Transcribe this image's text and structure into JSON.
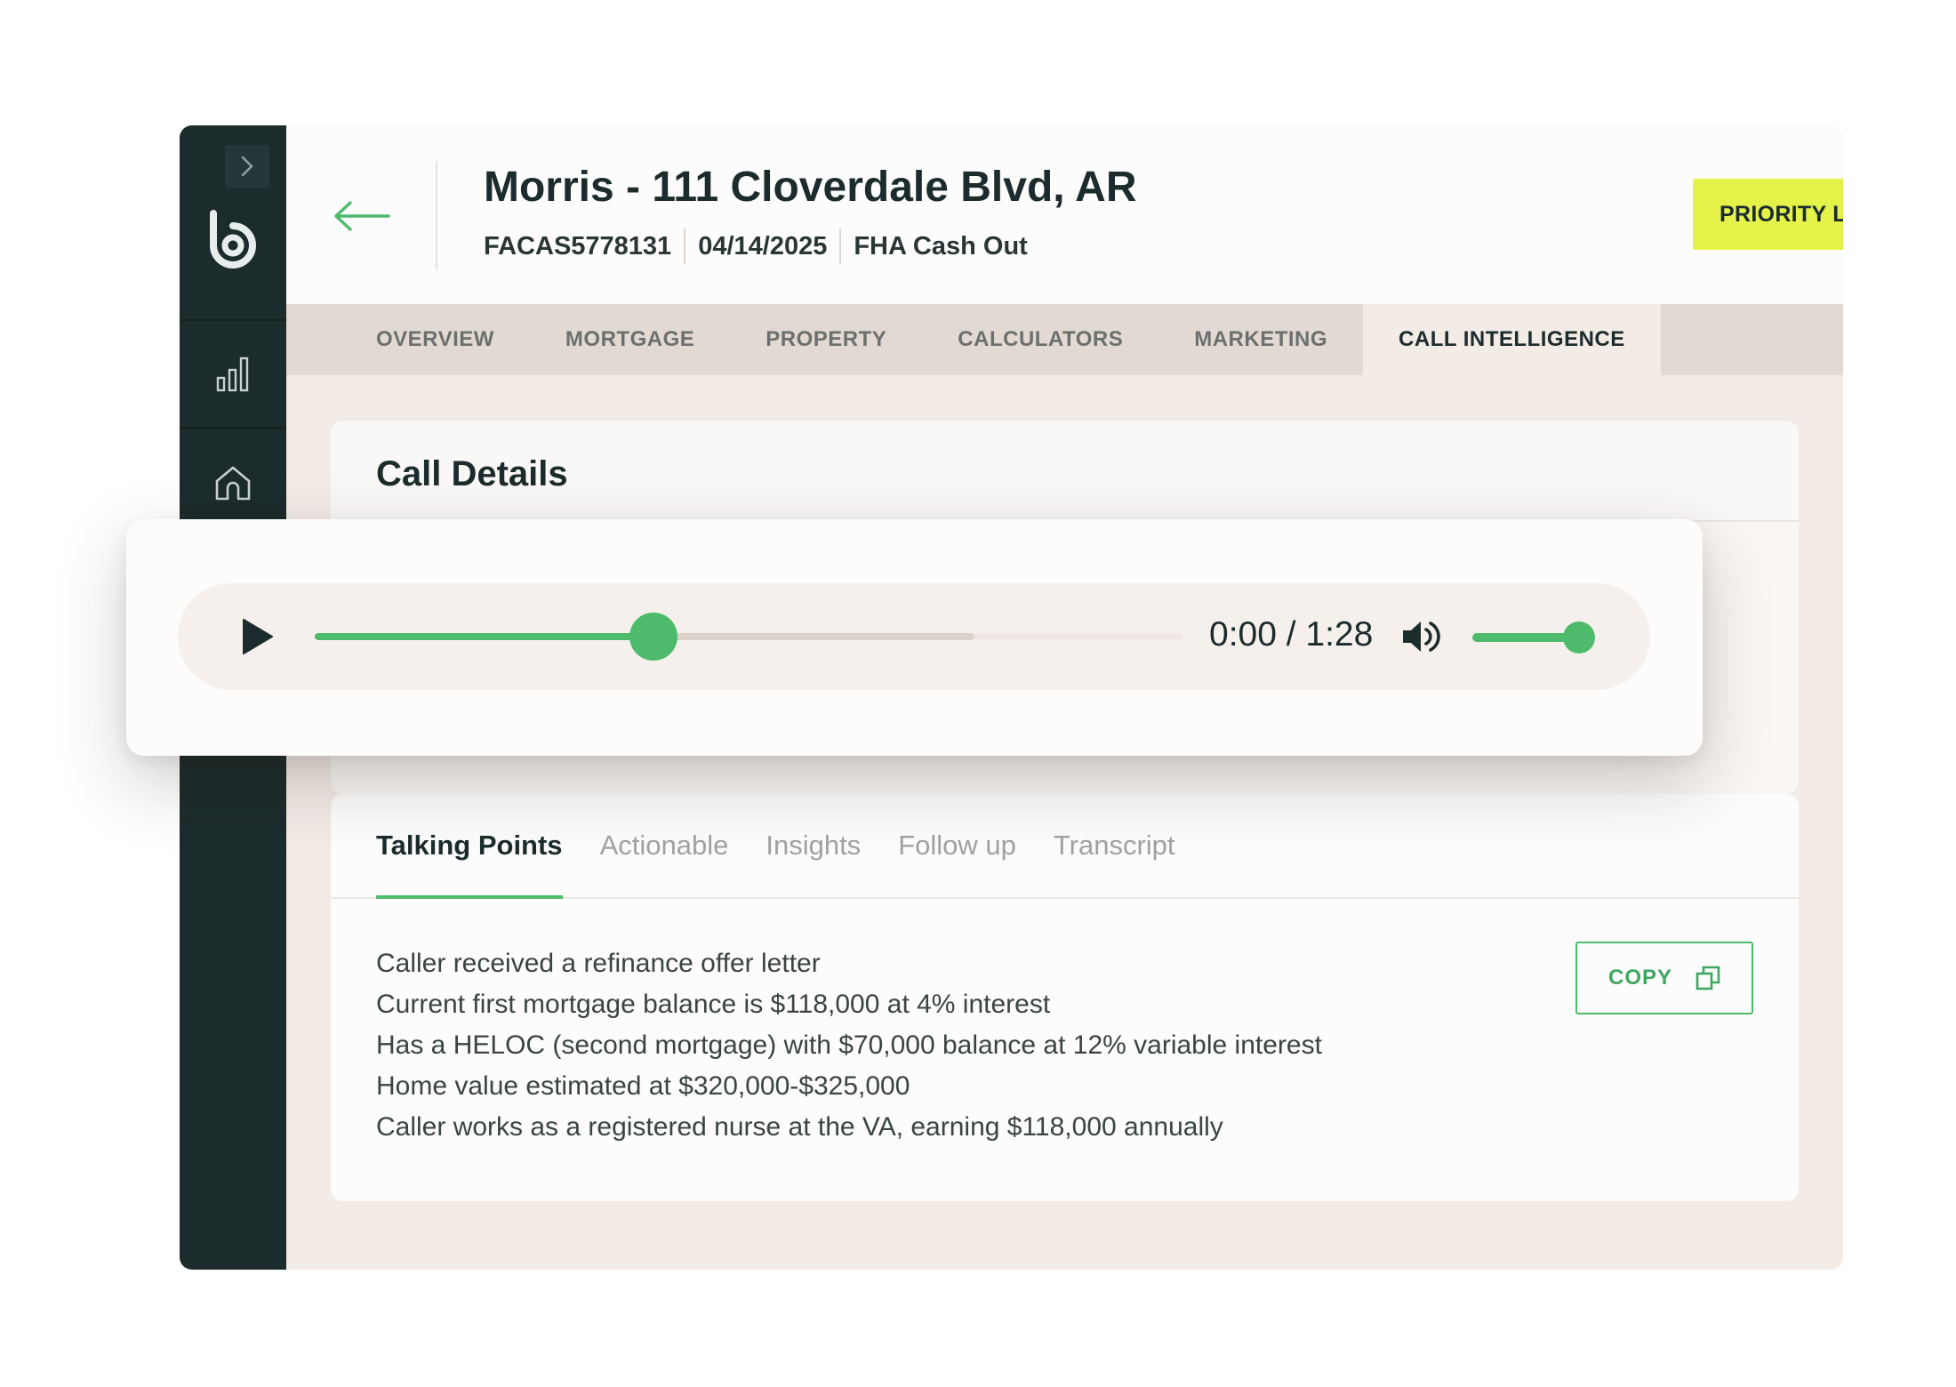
{
  "header": {
    "title": "Morris - 111 Cloverdale Blvd, AR",
    "loan_id": "FACAS5778131",
    "date": "04/14/2025",
    "loan_type": "FHA Cash Out",
    "priority_label": "PRIORITY LEAD"
  },
  "tabs": [
    {
      "label": "OVERVIEW",
      "active": false
    },
    {
      "label": "MORTGAGE",
      "active": false
    },
    {
      "label": "PROPERTY",
      "active": false
    },
    {
      "label": "CALCULATORS",
      "active": false
    },
    {
      "label": "MARKETING",
      "active": false
    },
    {
      "label": "CALL INTELLIGENCE",
      "active": true
    }
  ],
  "call_details": {
    "title": "Call Details"
  },
  "player": {
    "time_display": "0:00 / 1:28",
    "progress": 0.39,
    "buffered": 0.76,
    "volume": 0.94
  },
  "sub_tabs": [
    {
      "label": "Talking Points",
      "active": true
    },
    {
      "label": "Actionable",
      "active": false
    },
    {
      "label": "Insights",
      "active": false
    },
    {
      "label": "Follow up",
      "active": false
    },
    {
      "label": "Transcript",
      "active": false
    }
  ],
  "talking_points": [
    "Caller received a refinance offer letter",
    "Current first mortgage balance is $118,000 at 4% interest",
    "Has a HELOC (second mortgage) with $70,000 balance at 12% variable interest",
    "Home value estimated at $320,000-$325,000",
    "Caller works as a registered nurse at the VA, earning $118,000 annually"
  ],
  "copy_label": "COPY",
  "colors": {
    "sidebar": "#1c2b2c",
    "accent_green": "#4dbb6b",
    "priority_yellow": "#e4f24a",
    "panel_background": "#f2ebe6"
  },
  "icons": {
    "sidebar": [
      "chevron-right-icon",
      "logo-icon",
      "bar-chart-icon",
      "home-icon"
    ],
    "header": [
      "back-arrow-icon",
      "star-icon"
    ],
    "player": [
      "play-icon",
      "volume-icon"
    ],
    "copy": "copy-icon"
  }
}
